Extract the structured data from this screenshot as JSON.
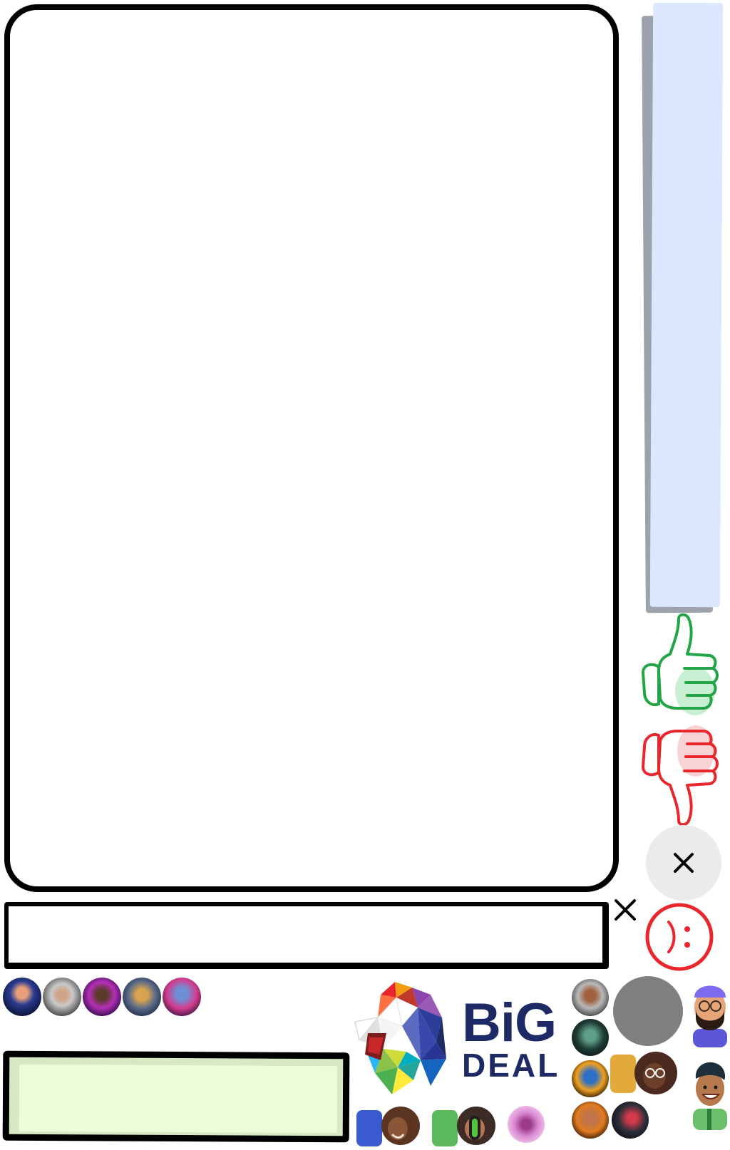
{
  "logo": {
    "line1": "BiG",
    "line2": "DEAL"
  },
  "colors": {
    "side_panel": "#dbe7fd",
    "side_panel_shadow": "#9ca3ad",
    "thumbs_up": "#22a447",
    "thumbs_down": "#e8262b",
    "note_fill": "#ecfbd8",
    "brand_text": "#1d2a66"
  },
  "icons": {
    "feedback": [
      "thumbs-up-icon",
      "thumbs-down-icon",
      "close-icon",
      "sad-face-icon"
    ],
    "input": "close-icon",
    "avatars_row_count": 5,
    "emoji_avatars": [
      "bearded-man-beanie-icon",
      "smiling-man-icon",
      "curly-hair-avatar-icon",
      "afro-avatar-icon"
    ]
  }
}
